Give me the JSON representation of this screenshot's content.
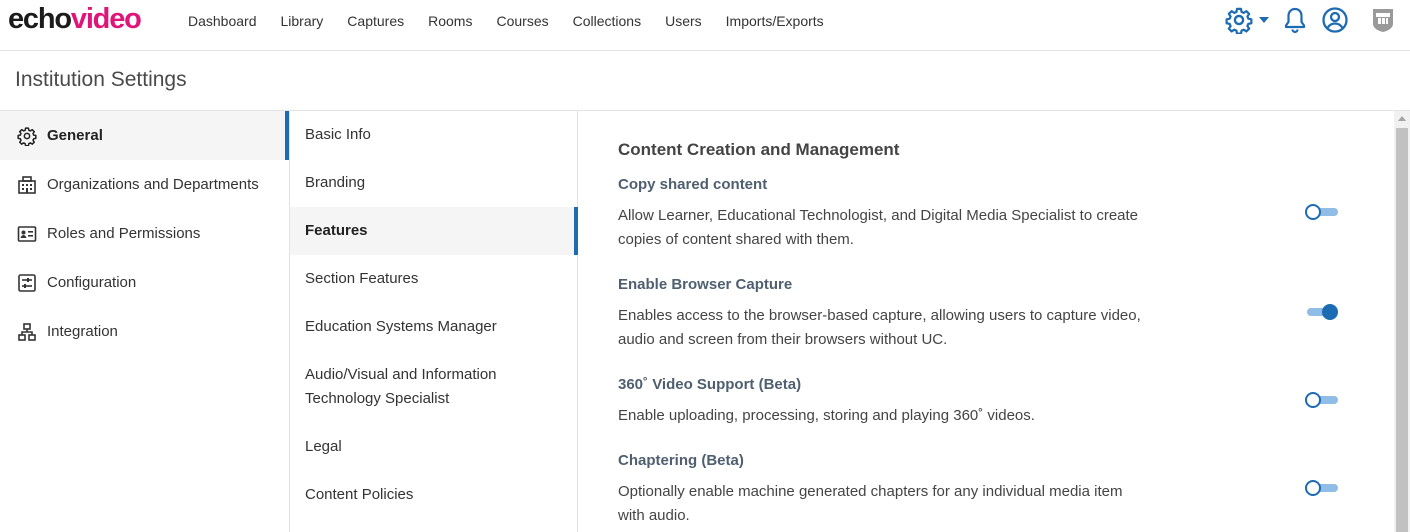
{
  "app": {
    "logo_part1": "echo",
    "logo_part2": "video",
    "brand_color": "#e0157a",
    "accent_color": "#1d6bb3"
  },
  "nav": {
    "items": [
      "Dashboard",
      "Library",
      "Captures",
      "Rooms",
      "Courses",
      "Collections",
      "Users",
      "Imports/Exports"
    ]
  },
  "header_icons": [
    "settings-gear-icon",
    "caret-down-icon",
    "bell-icon",
    "user-circle-icon",
    "app-badge-icon"
  ],
  "page": {
    "title": "Institution Settings"
  },
  "sidebar": {
    "items": [
      {
        "label": "General",
        "icon": "gear-icon",
        "active": true
      },
      {
        "label": "Organizations and Departments",
        "icon": "building-icon",
        "active": false
      },
      {
        "label": "Roles and Permissions",
        "icon": "id-card-icon",
        "active": false
      },
      {
        "label": "Configuration",
        "icon": "sliders-icon",
        "active": false
      },
      {
        "label": "Integration",
        "icon": "network-icon",
        "active": false
      }
    ]
  },
  "subnav": {
    "items": [
      {
        "label": "Basic Info",
        "active": false
      },
      {
        "label": "Branding",
        "active": false
      },
      {
        "label": "Features",
        "active": true
      },
      {
        "label": "Section Features",
        "active": false
      },
      {
        "label": "Education Systems Manager",
        "active": false
      },
      {
        "label_line1": "Audio/Visual and Information",
        "label_line2": "Technology Specialist",
        "active": false
      },
      {
        "label": "Legal",
        "active": false
      },
      {
        "label": "Content Policies",
        "active": false
      }
    ]
  },
  "content": {
    "section_title": "Content Creation and Management",
    "features": [
      {
        "title": "Copy shared content",
        "desc_line1": "Allow Learner, Educational Technologist, and Digital Media Specialist to create",
        "desc_line2": "copies of content shared with them.",
        "enabled": false
      },
      {
        "title": "Enable Browser Capture",
        "desc_line1": "Enables access to the browser-based capture, allowing users to capture video,",
        "desc_line2": "audio and screen from their browsers without UC.",
        "enabled": true
      },
      {
        "title": "360˚ Video Support (Beta)",
        "desc_line1": "Enable uploading, processing, storing and playing 360˚ videos.",
        "enabled": false
      },
      {
        "title": "Chaptering (Beta)",
        "desc_line1": "Optionally enable machine generated chapters for any individual media item",
        "desc_line2": "with audio.",
        "enabled": false
      }
    ]
  }
}
